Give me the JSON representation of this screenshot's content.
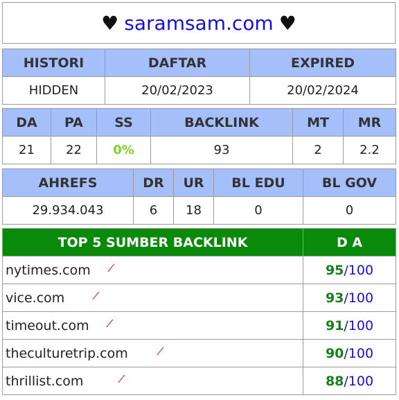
{
  "header": {
    "heart_left": "♥",
    "site": "saramsam.com",
    "heart_right": "♥"
  },
  "table1": {
    "headers": [
      "HISTORI",
      "DAFTAR",
      "EXPIRED"
    ],
    "values": [
      "HIDDEN",
      "20/02/2023",
      "20/02/2024"
    ]
  },
  "table2": {
    "headers": [
      "DA",
      "PA",
      "SS",
      "BACKLINK",
      "MT",
      "MR"
    ],
    "values": [
      "21",
      "22",
      "0%",
      "93",
      "2",
      "2.2"
    ]
  },
  "table3": {
    "headers": [
      "AHREFS",
      "DR",
      "UR",
      "BL EDU",
      "BL GOV"
    ],
    "values": [
      "29.934.043",
      "6",
      "18",
      "0",
      "0"
    ]
  },
  "backlinks": {
    "header_source": "TOP 5 SUMBER BACKLINK",
    "header_da": "D A",
    "mark": "⁄",
    "rows": [
      {
        "site": "nytimes.com",
        "da": "95",
        "max": "/100"
      },
      {
        "site": "vice.com",
        "da": "93",
        "max": "/100"
      },
      {
        "site": "timeout.com",
        "da": "91",
        "max": "/100"
      },
      {
        "site": "theculturetrip.com",
        "da": "90",
        "max": "/100"
      },
      {
        "site": "thrillist.com",
        "da": "88",
        "max": "/100"
      }
    ]
  },
  "colors": {
    "header_blue": "#a4bffa",
    "green_header": "#0a8a0a",
    "link_blue": "#1a0fd6",
    "da_green": "#17801a"
  }
}
